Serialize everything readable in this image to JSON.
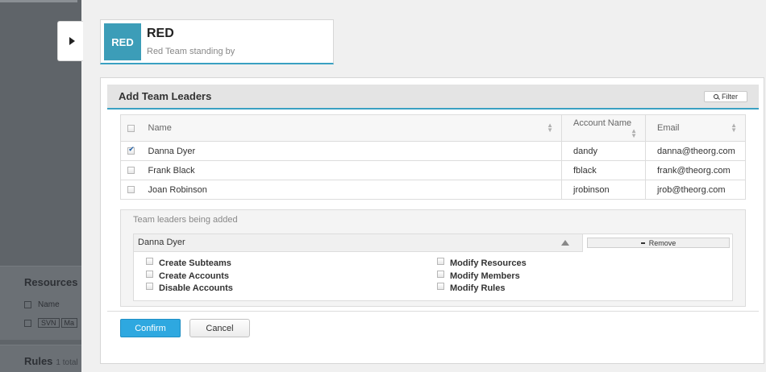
{
  "background": {
    "sections": [
      {
        "title": "Resources",
        "subtitle": "",
        "rows": [
          {
            "label": "Name",
            "tags": []
          },
          {
            "label": "",
            "tags": [
              "SVN",
              "Ma"
            ]
          }
        ]
      },
      {
        "title": "Rules",
        "subtitle": "1 total",
        "rows": []
      }
    ]
  },
  "team": {
    "badge": "RED",
    "name": "RED",
    "status": "Red Team standing by"
  },
  "panel": {
    "title": "Add Team Leaders",
    "filter_label": "Filter"
  },
  "table": {
    "headers": {
      "name": "Name",
      "account": "Account Name",
      "email": "Email"
    },
    "rows": [
      {
        "checked": true,
        "name": "Danna Dyer",
        "account": "dandy",
        "email": "danna@theorg.com"
      },
      {
        "checked": false,
        "name": "Frank Black",
        "account": "fblack",
        "email": "frank@theorg.com"
      },
      {
        "checked": false,
        "name": "Joan Robinson",
        "account": "jrobinson",
        "email": "jrob@theorg.com"
      }
    ]
  },
  "added": {
    "heading": "Team leaders being added",
    "leader_name": "Danna Dyer",
    "remove_label": "Remove",
    "permissions_left": [
      "Create Subteams",
      "Create Accounts",
      "Disable Accounts"
    ],
    "permissions_right": [
      "Modify Resources",
      "Modify Members",
      "Modify Rules"
    ]
  },
  "buttons": {
    "confirm": "Confirm",
    "cancel": "Cancel"
  },
  "colors": {
    "accent": "#3aa0c2",
    "badge": "#3c9db8",
    "primary_button": "#2ea8e0"
  }
}
